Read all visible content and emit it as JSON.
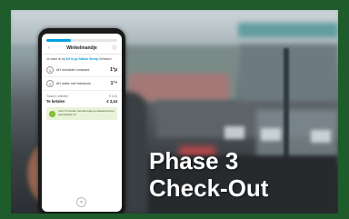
{
  "phone": {
    "header": {
      "title": "Winkelmandje",
      "back_icon": "chevron-left-icon",
      "menu_icon": "info-icon"
    },
    "info_text_prefix": "Je scant nu bij",
    "info_text_store": "AH to go Station Weesp",
    "info_text_suffix": "Selhaven",
    "items": [
      {
        "qty": "1",
        "name": "AH mondster croissant",
        "price": "1²µ"
      },
      {
        "qty": "1",
        "name": "AH water met framboos",
        "price": "1¹⁹"
      }
    ],
    "summary": {
      "subtotal_label": "Totaal 2 artikelen",
      "subtotal_value": "€ 3,44",
      "total_label": "Te betalen",
      "total_value": "€ 3,44"
    },
    "promo": {
      "icon": "leaf-icon",
      "text": "Voor 5 minuten niemand aan je kassa/scanner automatisch af"
    },
    "close_icon": "close-icon"
  },
  "caption": {
    "line1": "Phase 3",
    "line2": "Check-Out"
  },
  "colors": {
    "frame": "#1f5c2c",
    "accent": "#00a0e2",
    "promo_bg": "#e9f3da"
  }
}
